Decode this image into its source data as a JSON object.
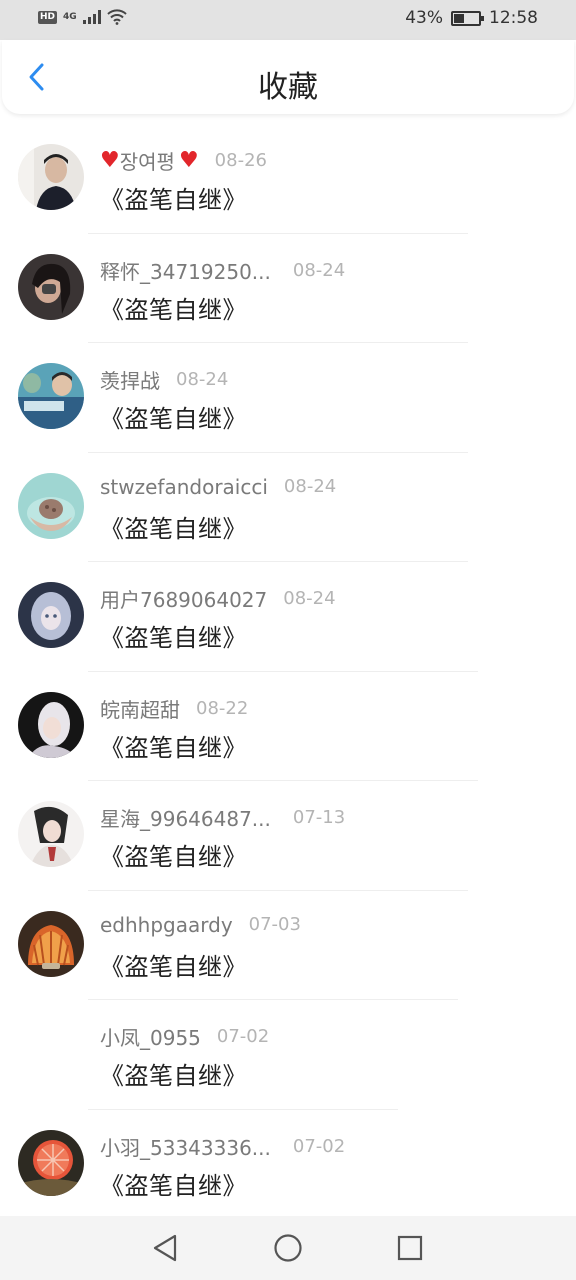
{
  "status_bar": {
    "hd_badge": "HD",
    "network": "4G",
    "battery_percent": "43%",
    "battery_level": 0.43,
    "time": "12:58"
  },
  "header": {
    "title": "收藏"
  },
  "items": [
    {
      "user": "장여평",
      "hearts": true,
      "date": "08-26",
      "book": "《盗笔自继》"
    },
    {
      "user": "释怀_34719250...",
      "hearts": false,
      "date": "08-24",
      "book": "《盗笔自继》"
    },
    {
      "user": "羡捍战",
      "hearts": false,
      "date": "08-24",
      "book": "《盗笔自继》"
    },
    {
      "user": "stwzefandoraicci",
      "hearts": false,
      "date": "08-24",
      "book": "《盗笔自继》"
    },
    {
      "user": "用户7689064027",
      "hearts": false,
      "date": "08-24",
      "book": "《盗笔自继》"
    },
    {
      "user": "皖南超甜",
      "hearts": false,
      "date": "08-22",
      "book": "《盗笔自继》"
    },
    {
      "user": "星海_99646487...",
      "hearts": false,
      "date": "07-13",
      "book": "《盗笔自继》"
    },
    {
      "user": "edhhpgaardy",
      "hearts": false,
      "date": "07-03",
      "book": "《盗笔自继》"
    },
    {
      "user": "小凤_0955",
      "hearts": false,
      "date": "07-02",
      "book": "《盗笔自继》"
    },
    {
      "user": "小羽_53343336...",
      "hearts": false,
      "date": "07-02",
      "book": "《盗笔自继》"
    }
  ],
  "icons": {
    "back": "chevron-left-icon",
    "nav_back": "triangle-back-icon",
    "nav_home": "circle-home-icon",
    "nav_recent": "square-recent-icon"
  },
  "colors": {
    "accent": "#2d8cf0",
    "heart": "#e2262b",
    "username": "#7a7a7a",
    "date": "#b4b4b4"
  }
}
